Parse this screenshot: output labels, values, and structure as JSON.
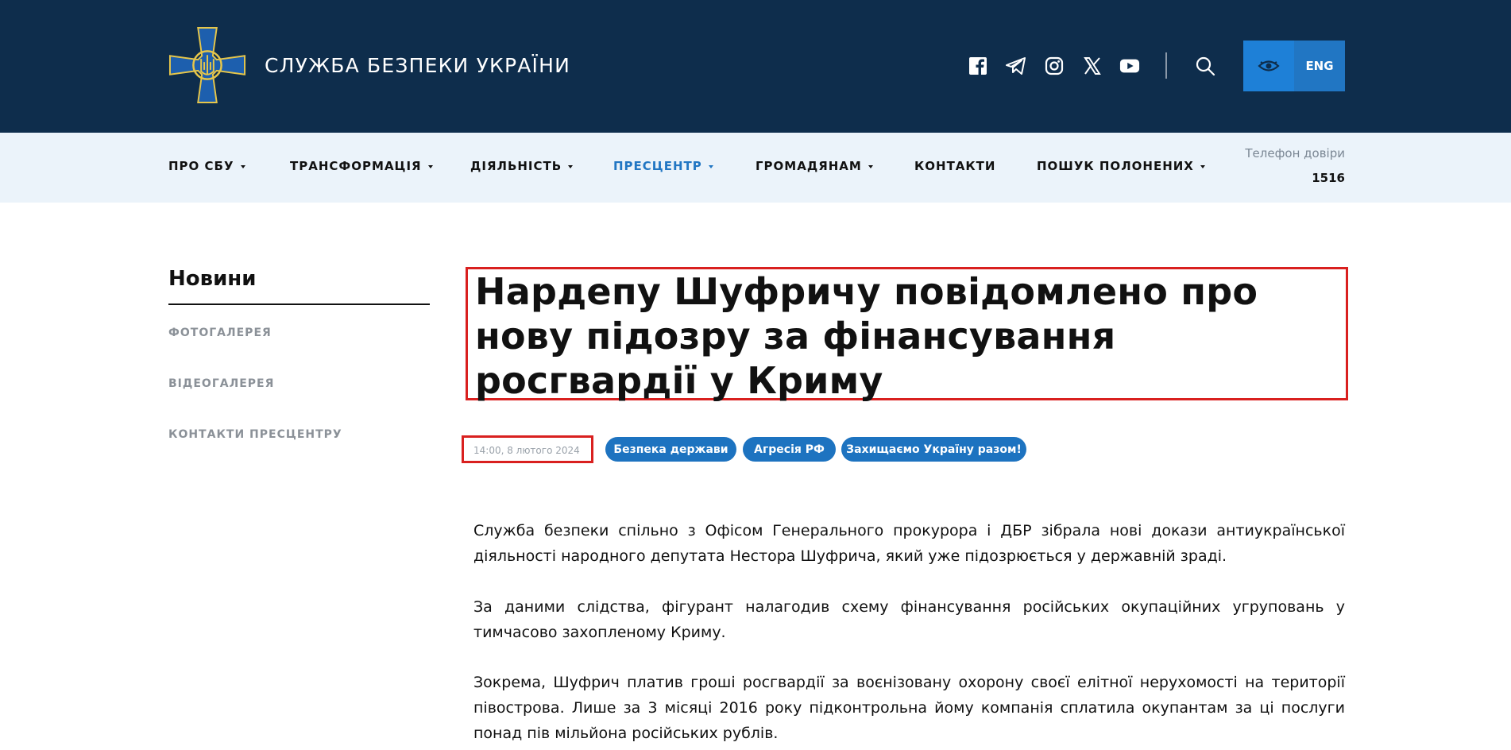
{
  "header": {
    "brand": "СЛУЖБА БЕЗПЕКИ УКРАЇНИ",
    "lang_button": "ENG",
    "colors": {
      "header_bg": "#0e2d4c",
      "accent": "#2176c3",
      "nav_bg": "#ebf3fa",
      "highlight": "#d9201f"
    }
  },
  "social": [
    "facebook-icon",
    "telegram-icon",
    "instagram-icon",
    "x-icon",
    "youtube-icon"
  ],
  "nav": {
    "items": [
      {
        "label": "ПРО СБУ"
      },
      {
        "label": "ТРАНСФОРМАЦІЯ"
      },
      {
        "label": "ДІЯЛЬНІСТЬ"
      },
      {
        "label": "ПРЕСЦЕНТР"
      },
      {
        "label": "ГРОМАДЯНАМ"
      },
      {
        "label": "КОНТАКТИ"
      },
      {
        "label": "ПОШУК ПОЛОНЕНИХ"
      }
    ],
    "trust_label": "Телефон довіри",
    "trust_number": "1516"
  },
  "sidebar": {
    "title": "Новини",
    "links": [
      "ФОТОГАЛЕРЕЯ",
      "ВІДЕОГАЛЕРЕЯ",
      "КОНТАКТИ ПРЕСЦЕНТРУ"
    ]
  },
  "article": {
    "title": "Нардепу Шуфричу повідомлено про нову підозру за фінансування росгвардії у Криму",
    "date": "14:00, 8 лютого 2024",
    "tags": [
      "Безпека держави",
      "Агресія РФ",
      "Захищаємо Україну разом!"
    ],
    "paragraphs": [
      "Служба безпеки спільно з Офісом Генерального прокурора і ДБР зібрала нові докази антиукраїнської діяльності народного депутата Нестора Шуфрича, який уже підозрюється у державній зраді.",
      "За даними слідства, фігурант налагодив схему фінансування російських окупаційних угруповань у тимчасово захопленому Криму.",
      "Зокрема, Шуфрич платив гроші росгвардії за воєнізовану охорону своєї елітної нерухомості на території півострова. Лише за 3 місяці 2016 року підконтрольна йому компанія сплатила окупантам за ці послуги понад пів мільйона російських рублів."
    ]
  }
}
